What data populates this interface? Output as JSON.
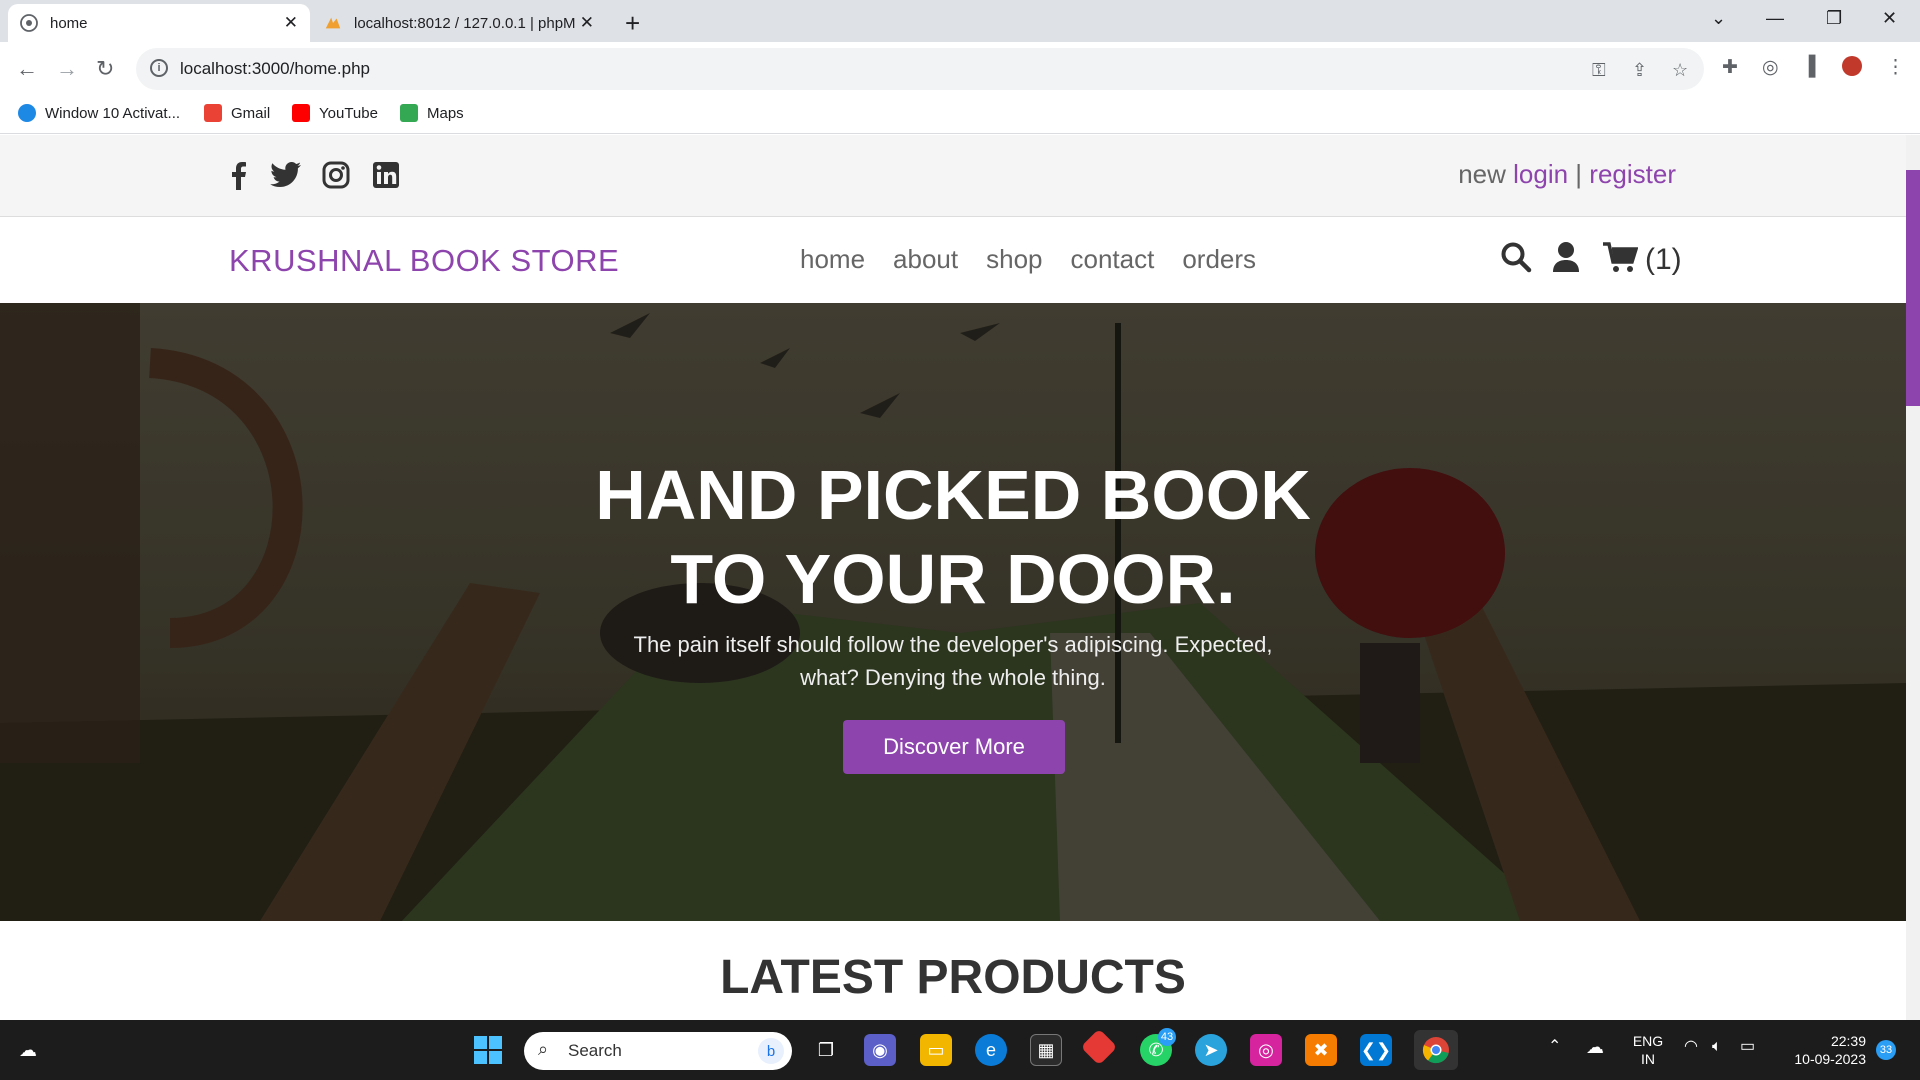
{
  "browser": {
    "tabs": [
      {
        "title": "home",
        "icon": "globe-icon"
      },
      {
        "title": "localhost:8012 / 127.0.0.1 | phpM",
        "icon": "phpmyadmin-icon"
      }
    ],
    "url": "localhost:3000/home.php",
    "bookmarks": [
      {
        "label": "Window 10 Activat...",
        "color": "#1e88e5"
      },
      {
        "label": "Gmail",
        "color": "#ea4335"
      },
      {
        "label": "YouTube",
        "color": "#ff0000"
      },
      {
        "label": "Maps",
        "color": "#34a853"
      }
    ]
  },
  "site": {
    "brand_color": "#8e44ad",
    "auth": {
      "new_text": "new",
      "login": "login",
      "separator": "|",
      "register": "register"
    },
    "logo": "KRUSHNAL BOOK STORE",
    "nav": [
      "home",
      "about",
      "shop",
      "contact",
      "orders"
    ],
    "cart_count": "(1)",
    "hero": {
      "title_line1": "HAND PICKED BOOK",
      "title_line2": "TO YOUR DOOR.",
      "subtitle_line1": "The pain itself should follow the developer's adipiscing. Expected,",
      "subtitle_line2": "what? Denying the whole thing.",
      "button": "Discover More"
    },
    "section_title": "LATEST PRODUCTS"
  },
  "taskbar": {
    "search_placeholder": "Search",
    "whatsapp_badge": "43",
    "lang_line1": "ENG",
    "lang_line2": "IN",
    "time": "22:39",
    "date": "10-09-2023",
    "notification_count": "33"
  }
}
